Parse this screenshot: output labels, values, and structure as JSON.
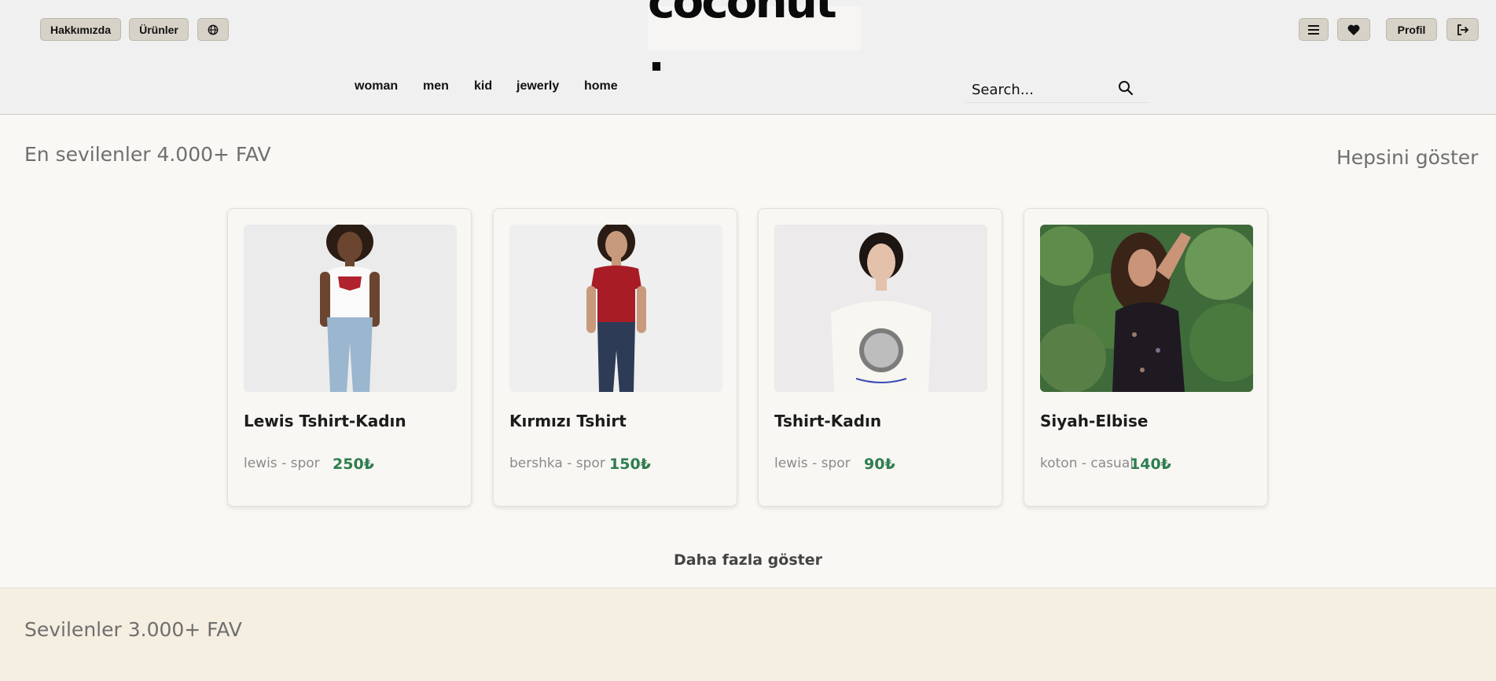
{
  "header": {
    "about_label": "Hakkımızda",
    "products_label": "Ürünler",
    "language_icon": "globe-icon",
    "logo_text": "coconut .",
    "menu_icon": "hamburger-icon",
    "favorites_icon": "heart-icon",
    "profile_label": "Profil",
    "logout_icon": "sign-out-icon"
  },
  "nav": {
    "items": [
      "woman",
      "men",
      "kid",
      "jewerly",
      "home"
    ]
  },
  "search": {
    "placeholder": "Search...",
    "icon": "search-icon"
  },
  "most_loved": {
    "title": "En sevilenler  4.000+ FAV",
    "show_all": "Hepsini göster",
    "products": [
      {
        "name": "Lewis Tshirt-Kadın",
        "meta": "lewis - spor",
        "price": "250₺",
        "image": "woman-white-levis-tshirt-jeans"
      },
      {
        "name": "Kırmızı Tshirt",
        "meta": "bershka - spor",
        "price": "150₺",
        "image": "woman-red-vneck-tshirt-jeans"
      },
      {
        "name": "Tshirt-Kadın",
        "meta": "lewis - spor",
        "price": "90₺",
        "image": "woman-white-graphic-tshirt"
      },
      {
        "name": "Siyah-Elbise",
        "meta": "koton - casual",
        "price": "140₺",
        "image": "woman-black-sequin-dress-trees"
      }
    ],
    "more_label": "Daha fazla göster"
  },
  "loved": {
    "title": "Sevilenler  3.000+ FAV"
  },
  "colors": {
    "accent_price": "#2e7d4f",
    "header_bg": "#f1f0f1",
    "button_bg": "#d6d2c7",
    "section2_bg": "#f5efe1"
  }
}
